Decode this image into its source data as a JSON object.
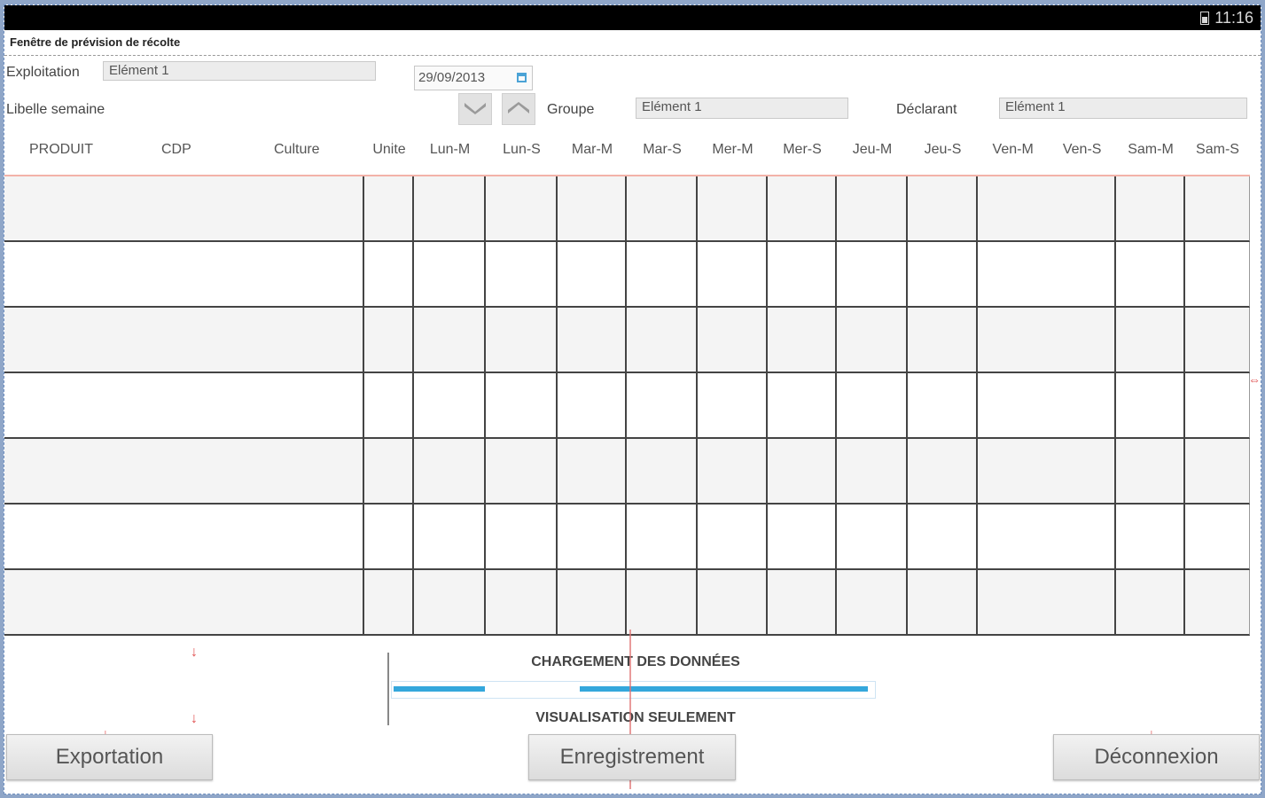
{
  "status_bar": {
    "time": "11:16",
    "battery_icon": "battery-icon"
  },
  "window": {
    "title": "Fenêtre de prévision de récolte"
  },
  "form": {
    "exploitation_label": "Exploitation",
    "exploitation_value": "Elément 1",
    "date_value": "29/09/2013",
    "semaine_label": "Libelle semaine",
    "groupe_label": "Groupe",
    "groupe_value": "Elément 1",
    "declarant_label": "Déclarant",
    "declarant_value": "Elément 1"
  },
  "table": {
    "headers": [
      "PRODUIT",
      "CDP",
      "Culture",
      "Unite",
      "Lun-M",
      "Lun-S",
      "Mar-M",
      "Mar-S",
      "Mer-M",
      "Mer-S",
      "Jeu-M",
      "Jeu-S",
      "Ven-M",
      "Ven-S",
      "Sam-M",
      "Sam-S"
    ],
    "row_count": 7
  },
  "loading": {
    "top_text": "CHARGEMENT DES DONNÉES",
    "bottom_text": "VISUALISATION SEULEMENT",
    "progress_segments": [
      0.38,
      0.6
    ]
  },
  "buttons": {
    "export": "Exportation",
    "save": "Enregistrement",
    "logout": "Déconnexion"
  },
  "colors": {
    "progress": "#34a7dc",
    "header_rule": "#f3b2a8"
  }
}
